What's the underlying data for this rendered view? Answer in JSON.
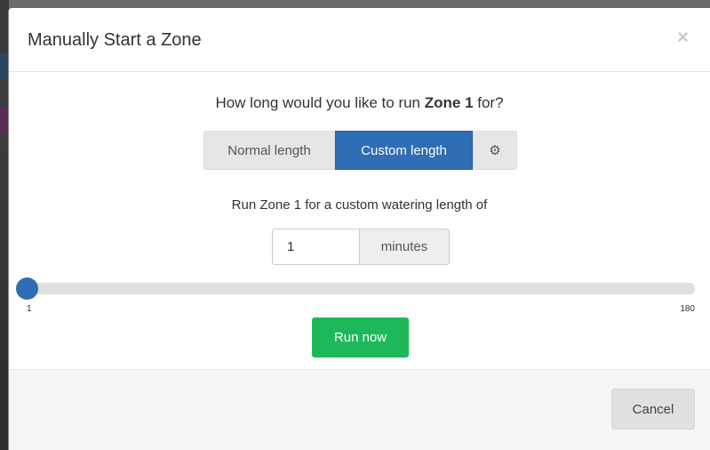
{
  "modal": {
    "title": "Manually Start a Zone",
    "close_symbol": "×"
  },
  "question": {
    "prefix": "How long would you like to run ",
    "zone_name": "Zone 1",
    "suffix": " for?"
  },
  "length_options": {
    "normal_label": "Normal length",
    "custom_label": "Custom length",
    "selected": "Custom length",
    "settings_icon": "gear-icon",
    "settings_glyph": "⚙"
  },
  "custom": {
    "description": "Run Zone 1 for a custom watering length of",
    "value": "1",
    "unit_label": "minutes"
  },
  "slider": {
    "min_label": "1",
    "max_label": "180",
    "min": 1,
    "max": 180,
    "value": 1
  },
  "actions": {
    "run_label": "Run now",
    "cancel_label": "Cancel"
  },
  "colors": {
    "primary": "#2f6db5",
    "success": "#1eb85b"
  }
}
